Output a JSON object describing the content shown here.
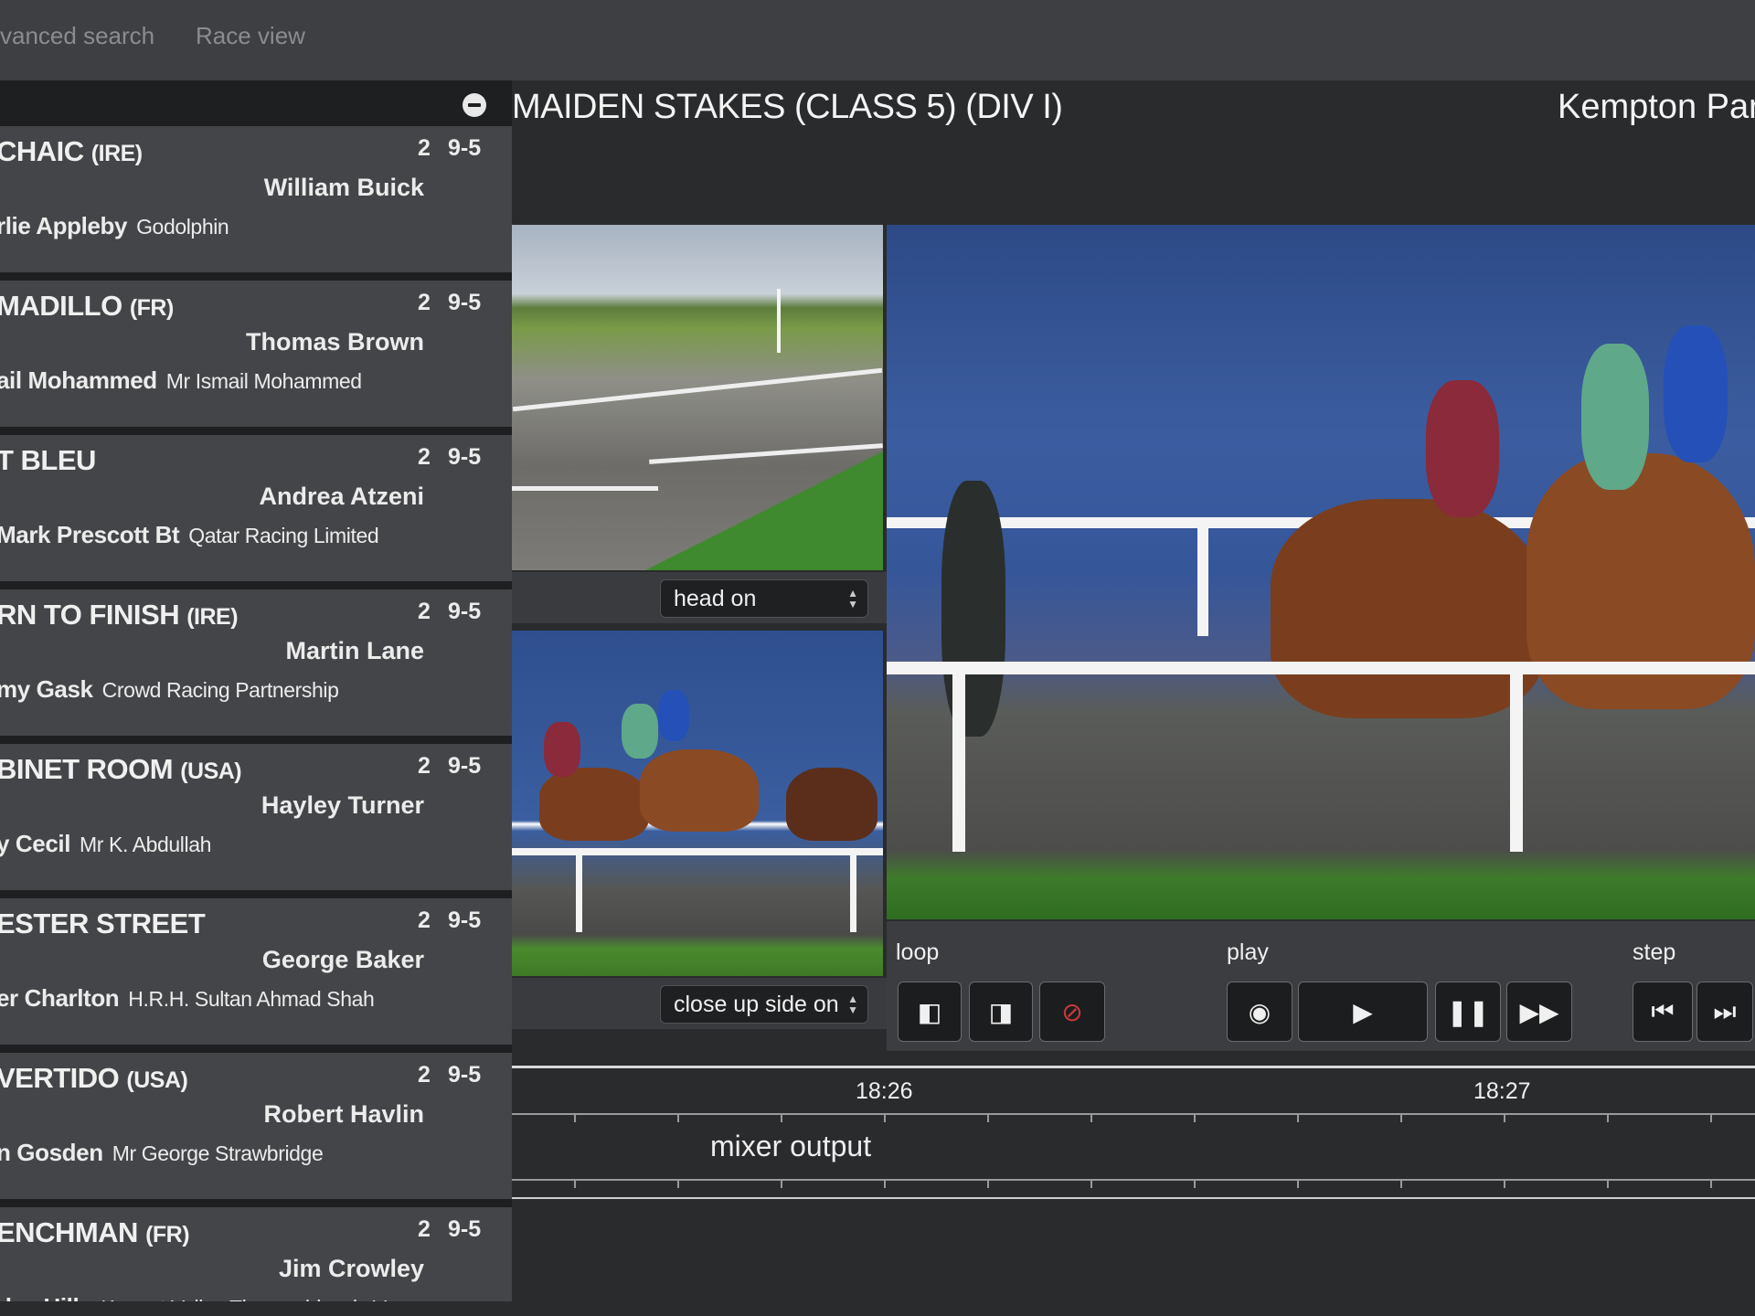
{
  "nav": {
    "tabs": [
      "vanced search",
      "Race view"
    ]
  },
  "race": {
    "title": "MAIDEN STAKES (CLASS 5) (DIV I)",
    "course": "Kempton Par"
  },
  "runners": [
    {
      "name": "CHAIC",
      "country": "(IRE)",
      "age": "2",
      "weight": "9-5",
      "jockey": "William Buick",
      "trainer": "rlie Appleby",
      "owner": "Godolphin"
    },
    {
      "name": "MADILLO",
      "country": "(FR)",
      "age": "2",
      "weight": "9-5",
      "jockey": "Thomas Brown",
      "trainer": "ail Mohammed",
      "owner": "Mr Ismail Mohammed"
    },
    {
      "name": "T BLEU",
      "country": "",
      "age": "2",
      "weight": "9-5",
      "jockey": "Andrea Atzeni",
      "trainer": "Mark Prescott Bt",
      "owner": "Qatar Racing Limited"
    },
    {
      "name": "RN TO FINISH",
      "country": "(IRE)",
      "age": "2",
      "weight": "9-5",
      "jockey": "Martin Lane",
      "trainer": "my Gask",
      "owner": "Crowd Racing Partnership"
    },
    {
      "name": "BINET ROOM",
      "country": "(USA)",
      "age": "2",
      "weight": "9-5",
      "jockey": "Hayley Turner",
      "trainer": "y Cecil",
      "owner": "Mr K. Abdullah"
    },
    {
      "name": "ESTER STREET",
      "country": "",
      "age": "2",
      "weight": "9-5",
      "jockey": "George Baker",
      "trainer": "er Charlton",
      "owner": "H.R.H. Sultan Ahmad Shah"
    },
    {
      "name": "VERTIDO",
      "country": "(USA)",
      "age": "2",
      "weight": "9-5",
      "jockey": "Robert Havlin",
      "trainer": "n Gosden",
      "owner": "Mr George Strawbridge"
    },
    {
      "name": "ENCHMAN",
      "country": "(FR)",
      "age": "2",
      "weight": "9-5",
      "jockey": "Jim Crowley",
      "trainer": "rles Hills",
      "owner": "Kennet Valley Thoroughbreds V"
    }
  ],
  "views": {
    "top_select": "head on",
    "bottom_select": "close up side on"
  },
  "controls": {
    "loop_label": "loop",
    "play_label": "play",
    "step_label": "step",
    "icons": [
      "loop-start-icon",
      "loop-end-icon",
      "loop-clear-icon",
      "play-circle-icon",
      "play-icon",
      "pause-icon",
      "fast-forward-icon",
      "step-back-icon",
      "step-forward-icon"
    ]
  },
  "timeline": {
    "times": [
      "18:26",
      "18:27"
    ],
    "track_label": "mixer output"
  },
  "colors": {
    "accent_stop": "#c83a3a",
    "panel": "#434548",
    "background": "#2a2b2d"
  }
}
